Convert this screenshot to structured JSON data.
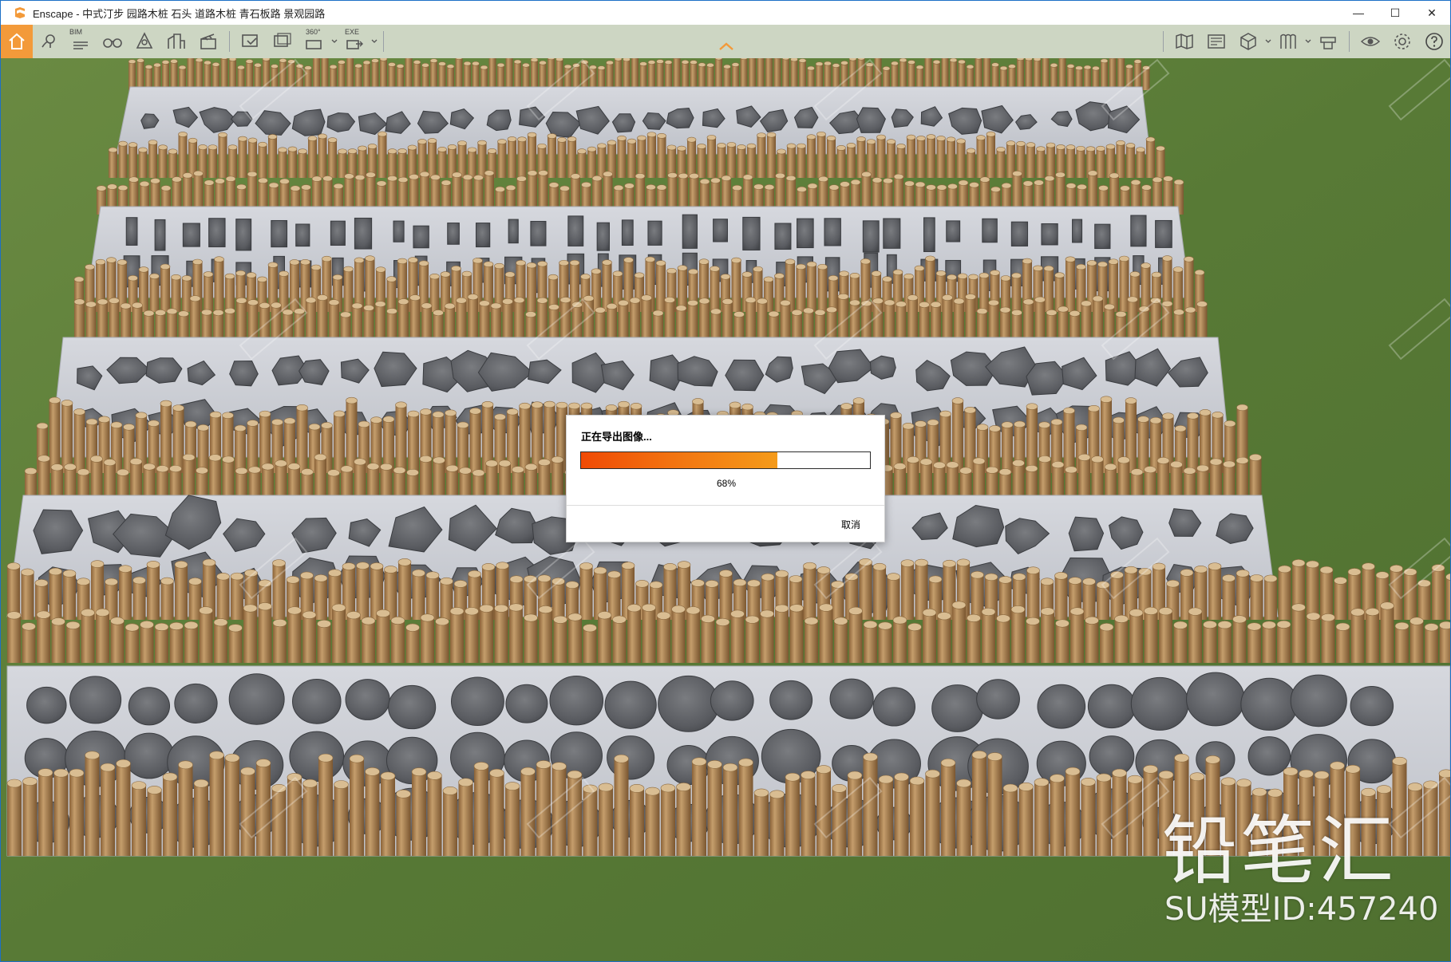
{
  "window": {
    "title": "Enscape - 中式汀步 园路木桩 石头 道路木桩 青石板路 景观园路",
    "controls": {
      "minimize": "—",
      "maximize": "☐",
      "close": "✕"
    }
  },
  "toolbar": {
    "bim_label": "BIM",
    "view360_label": "360°",
    "exe_label": "EXE",
    "icons": [
      "home-icon",
      "map-pin-icon",
      "bim-icon",
      "binoculars-icon",
      "asset-icon",
      "buildings-icon",
      "clapper-icon",
      "screenshot-icon",
      "batch-render-icon",
      "panorama-icon",
      "exe-export-icon",
      "map-icon",
      "material-icon",
      "views-icon",
      "library-icon",
      "video-icon",
      "visual-settings-icon",
      "settings-icon",
      "help-icon"
    ]
  },
  "dialog": {
    "title": "正在导出图像...",
    "progress_percent": 68,
    "progress_text": "68%",
    "cancel_label": "取消"
  },
  "watermark": {
    "brand": "铅笔汇",
    "id_text": "SU模型ID:457240"
  },
  "colors": {
    "accent": "#f39a3a",
    "progress_start": "#f04a05",
    "progress_end": "#f59b1a",
    "grass": "#5b7a38",
    "path": "#c7c9cf",
    "stone": "#5a5c60",
    "wood": "#b38a5a"
  }
}
